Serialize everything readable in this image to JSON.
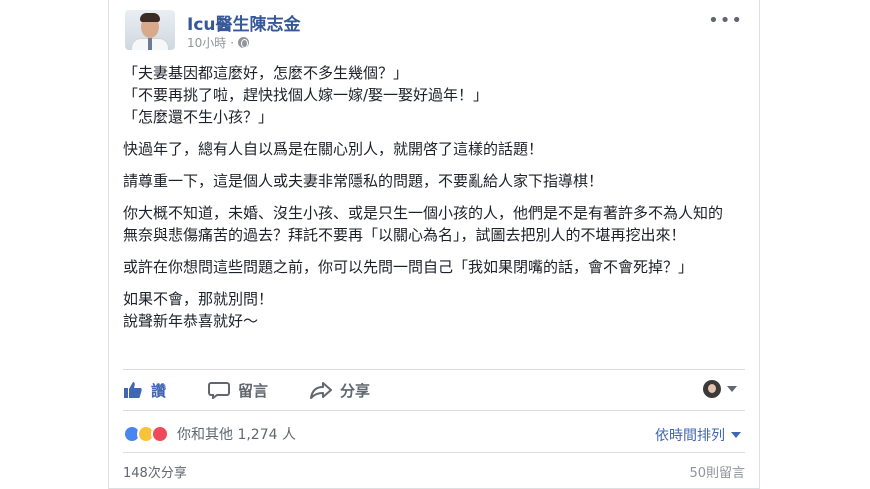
{
  "post": {
    "author": "Icu醫生陳志金",
    "time": "10小時",
    "separator": "·",
    "more": "•••",
    "paragraphs": [
      "「夫妻基因都這麼好，怎麼不多生幾個？」",
      "「不要再挑了啦，趕快找個人嫁一嫁/娶一娶好過年！」",
      "「怎麼還不生小孩？」",
      "快過年了，總有人自以爲是在關心別人，就開啓了這樣的話題！",
      "請尊重一下，這是個人或夫妻非常隱私的問題，不要亂給人家下指導棋！",
      "你大概不知道，未婚、沒生小孩、或是只生一個小孩的人，他們是不是有著許多不為人知的無奈與悲傷痛苦的過去？拜託不要再「以關心為名」，試圖去把別人的不堪再挖出來！",
      "或許在你想問這些問題之前，你可以先問一問自己「我如果閉嘴的話，會不會死掉？」",
      "如果不會，那就別問！",
      "說聲新年恭喜就好～"
    ]
  },
  "actions": {
    "like": "讚",
    "comment": "留言",
    "share": "分享"
  },
  "summary": {
    "reactions_text": "你和其他 1,274 人",
    "sort_label": "依時間排列",
    "shares": "148次分享",
    "comments": "50則留言"
  },
  "colors": {
    "link_blue": "#365899",
    "like_blue": "#4267b2",
    "text": "#1d2129",
    "muted": "#90949c"
  },
  "icons": [
    "avatar",
    "globe-icon",
    "more-icon",
    "like-icon",
    "comment-icon",
    "share-icon",
    "caret-down-icon",
    "reaction-like-icon",
    "reaction-haha-icon",
    "reaction-love-icon"
  ]
}
